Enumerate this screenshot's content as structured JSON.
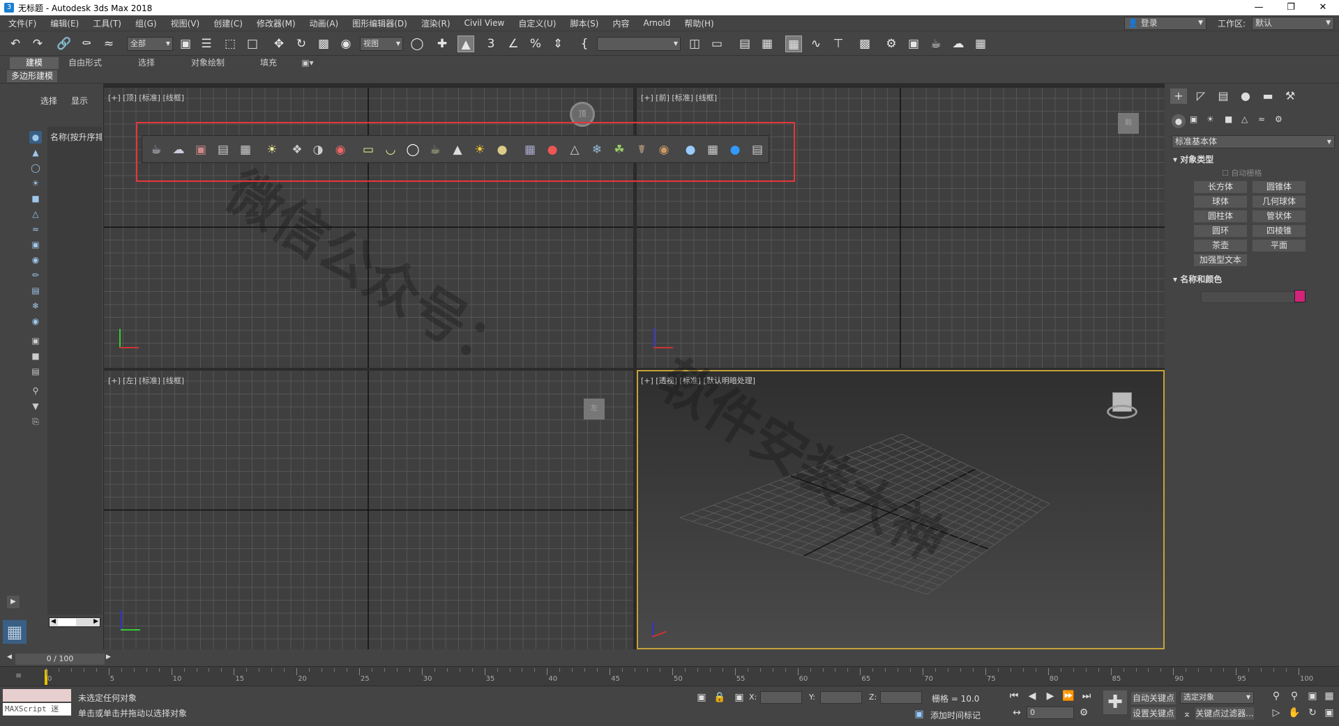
{
  "window": {
    "title": "无标题 - Autodesk 3ds Max 2018",
    "app_icon": "3"
  },
  "menu": [
    "文件(F)",
    "编辑(E)",
    "工具(T)",
    "组(G)",
    "视图(V)",
    "创建(C)",
    "修改器(M)",
    "动画(A)",
    "图形编辑器(D)",
    "渲染(R)",
    "Civil View",
    "自定义(U)",
    "脚本(S)",
    "内容",
    "Arnold",
    "帮助(H)"
  ],
  "account": {
    "login": "登录",
    "workspace_label": "工作区:",
    "workspace_value": "默认"
  },
  "toolbar": {
    "selection_filter": "全部",
    "ref_coord": "视图",
    "named_selection": ""
  },
  "ribbon": {
    "tabs": [
      "建模",
      "自由形式",
      "选择",
      "对象绘制",
      "填充"
    ],
    "active_tab": "建模",
    "sub_tab": "多边形建模"
  },
  "scene_explorer": {
    "tab_select": "选择",
    "tab_display": "显示",
    "column_header": "名称(按升序排"
  },
  "viewports": {
    "top": {
      "label": "[+] [顶] [标准] [线框]",
      "cube_label": "顶"
    },
    "front": {
      "label": "[+] [前] [标准] [线框]",
      "cube_label": "前"
    },
    "left": {
      "label": "[+] [左] [标准] [线框]",
      "cube_label": "左"
    },
    "perspective": {
      "label": "[+] [透视] [标准] [默认明暗处理]"
    }
  },
  "command_panel": {
    "category": "标准基本体",
    "rollout_object_type": "对象类型",
    "autogrid": "自动栅格",
    "buttons": [
      "长方体",
      "圆锥体",
      "球体",
      "几何球体",
      "圆柱体",
      "管状体",
      "圆环",
      "四棱锥",
      "茶壶",
      "平面",
      "加强型文本"
    ],
    "rollout_name_color": "名称和颜色",
    "object_color": "#d4237a"
  },
  "timeline": {
    "frame_display": "0 / 100",
    "ticks": [
      "0",
      "5",
      "10",
      "15",
      "20",
      "25",
      "30",
      "35",
      "40",
      "45",
      "50",
      "55",
      "60",
      "65",
      "70",
      "75",
      "80",
      "85",
      "90",
      "95",
      "100"
    ]
  },
  "status": {
    "maxscript_label": "MAXScript 迷",
    "message1": "未选定任何对象",
    "message2": "单击或单击并拖动以选择对象",
    "x_label": "X:",
    "y_label": "Y:",
    "z_label": "Z:",
    "grid_text": "栅格 = 10.0",
    "add_time_tag": "添加时间标记",
    "auto_key": "自动关键点",
    "selected_obj": "选定对象",
    "set_key": "设置关键点",
    "key_filters": "关键点过滤器...",
    "current_frame": "0"
  },
  "watermarks": [
    "微信公众号：",
    "软件安装大神"
  ]
}
